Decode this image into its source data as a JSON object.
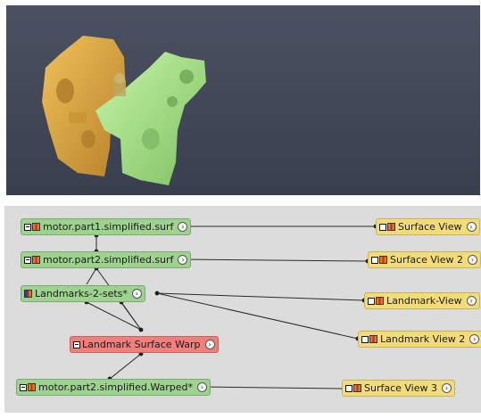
{
  "viewer": {
    "left_view_objects": [
      "motor.part1.simplified.surf",
      "motor.part2.simplified.surf"
    ],
    "right_view_objects": [
      "motor.part2.simplified.surf",
      "motor.part2.simplified.Warped*"
    ],
    "colors": {
      "background_top": "#4b5162",
      "background_bottom": "#3a3f4e",
      "part_yellow": "#e3a845",
      "part_green": "#a8e88a",
      "part_red": "#ec7a7a"
    }
  },
  "graph": {
    "nodes": {
      "part1": {
        "label": "motor.part1.simplified.surf",
        "type": "data",
        "toggle_icon": "minus-box-icon",
        "color_icon": "colormap-icon"
      },
      "part2": {
        "label": "motor.part2.simplified.surf",
        "type": "data",
        "toggle_icon": "minus-box-icon",
        "color_icon": "colormap-icon"
      },
      "landmarks": {
        "label": "Landmarks-2-sets*",
        "type": "data",
        "toggle_icon": "minus-box-icon",
        "color_icon": "colormap-blue-icon"
      },
      "warp": {
        "label": "Landmark Surface Warp",
        "type": "compute",
        "toggle_icon": "minus-box-icon"
      },
      "warped": {
        "label": "motor.part2.simplified.Warped*",
        "type": "data",
        "toggle_icon": "minus-box-icon",
        "color_icon": "colormap-icon"
      },
      "sv1": {
        "label": "Surface View",
        "type": "display",
        "toggle_icon": "checkbox-icon",
        "color_icon": "colormap-icon"
      },
      "sv2": {
        "label": "Surface View 2",
        "type": "display",
        "toggle_icon": "checkbox-icon",
        "color_icon": "colormap-icon"
      },
      "lv1": {
        "label": "Landmark-View",
        "type": "display",
        "toggle_icon": "checkbox-icon",
        "color_icon": "colormap-icon"
      },
      "lv2": {
        "label": "Landmark View 2",
        "type": "display",
        "toggle_icon": "checkbox-icon",
        "color_icon": "colormap-icon"
      },
      "sv3": {
        "label": "Surface View 3",
        "type": "display",
        "toggle_icon": "checkbox-icon",
        "color_icon": "colormap-icon"
      }
    },
    "arrow_glyph": "›",
    "colors": {
      "data": "#9ed28f",
      "compute": "#ee7f7b",
      "display": "#f2dc7a",
      "background": "#dcdcdc"
    }
  }
}
